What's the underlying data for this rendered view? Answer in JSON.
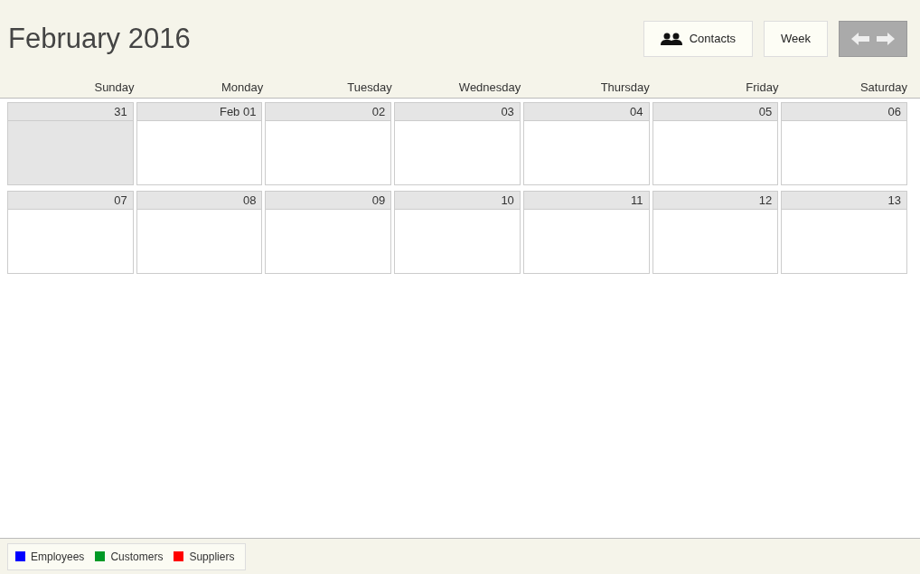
{
  "title": "February 2016",
  "buttons": [
    {
      "kind": "contacts",
      "label": "Contacts"
    },
    {
      "kind": "text",
      "label": "Week"
    }
  ],
  "weekdays": [
    "Sunday",
    "Monday",
    "Tuesday",
    "Wednesday",
    "Thursday",
    "Friday",
    "Saturday"
  ],
  "weeks": [
    [
      {
        "label": "31",
        "other_month": true
      },
      {
        "label": "Feb 01",
        "other_month": false
      },
      {
        "label": "02",
        "other_month": false
      },
      {
        "label": "03",
        "other_month": false
      },
      {
        "label": "04",
        "other_month": false
      },
      {
        "label": "05",
        "other_month": false
      },
      {
        "label": "06",
        "other_month": false
      }
    ],
    [
      {
        "label": "07",
        "other_month": false
      },
      {
        "label": "08",
        "other_month": false
      },
      {
        "label": "09",
        "other_month": false
      },
      {
        "label": "10",
        "other_month": false
      },
      {
        "label": "11",
        "other_month": false
      },
      {
        "label": "12",
        "other_month": false
      },
      {
        "label": "13",
        "other_month": false
      }
    ]
  ],
  "legend": [
    {
      "label": "Employees",
      "color": "#0000ff"
    },
    {
      "label": "Customers",
      "color": "#009926"
    },
    {
      "label": "Suppliers",
      "color": "#ff0000"
    }
  ]
}
